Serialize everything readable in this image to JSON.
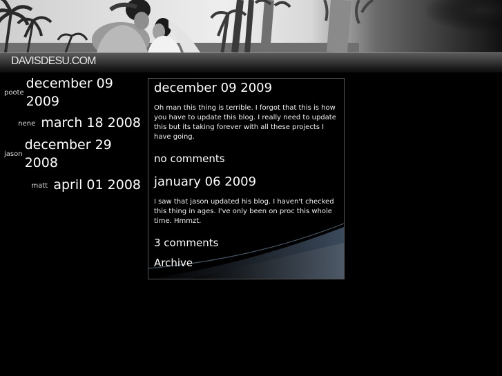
{
  "site": {
    "title": "DAVISDESU.COM"
  },
  "sidebar": {
    "entries": [
      {
        "author": "poote",
        "date": "december 09 2009"
      },
      {
        "author": "nene",
        "date": "march 18 2008"
      },
      {
        "author": "jason",
        "date": "december 29 2008"
      },
      {
        "author": "matt",
        "date": "april 01 2008"
      }
    ]
  },
  "main": {
    "posts": [
      {
        "date": "december 09 2009",
        "body": "Oh man this thing is terrible. I forgot that this is how you have to update this blog. I really need to update this but its taking forever with all these projects I have going.",
        "comments": "no comments"
      },
      {
        "date": "january 06 2009",
        "body": "I saw that jason updated his blog. I haven't checked this thing in ages. I've only been on proc this whole time. Hmmzt.",
        "comments": "3 comments"
      }
    ],
    "archive_label": "Archive"
  }
}
